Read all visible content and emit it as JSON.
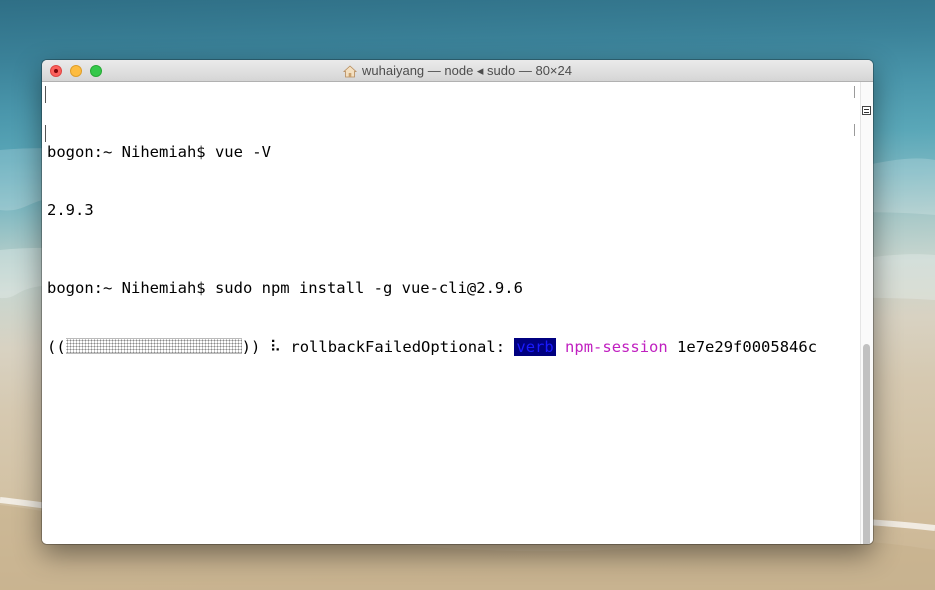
{
  "window": {
    "title": "wuhaiyang — node ◂ sudo — 80×24",
    "icons": {
      "title": "home-folder-icon",
      "close": "close-icon",
      "minimize": "minimize-icon",
      "zoom": "zoom-icon",
      "split": "split-pane-icon"
    }
  },
  "terminal": {
    "lines": [
      "bogon:~ Nihemiah$ vue -V",
      "2.9.3",
      "bogon:~ Nihemiah$ sudo npm install -g vue-cli@2.9.6"
    ],
    "progress": {
      "open": "((",
      "close": "))",
      "spinner": "⠧",
      "stage": "rollbackFailedOptional:",
      "verb_tag": "verb",
      "session_label": "npm-session",
      "session_id": "1e7e29f0005846c"
    }
  },
  "colors": {
    "verb_background": "#000080",
    "session_text": "#c020c0",
    "close": "#fc605c",
    "minimize": "#fdbc40",
    "zoom": "#34c84a"
  }
}
